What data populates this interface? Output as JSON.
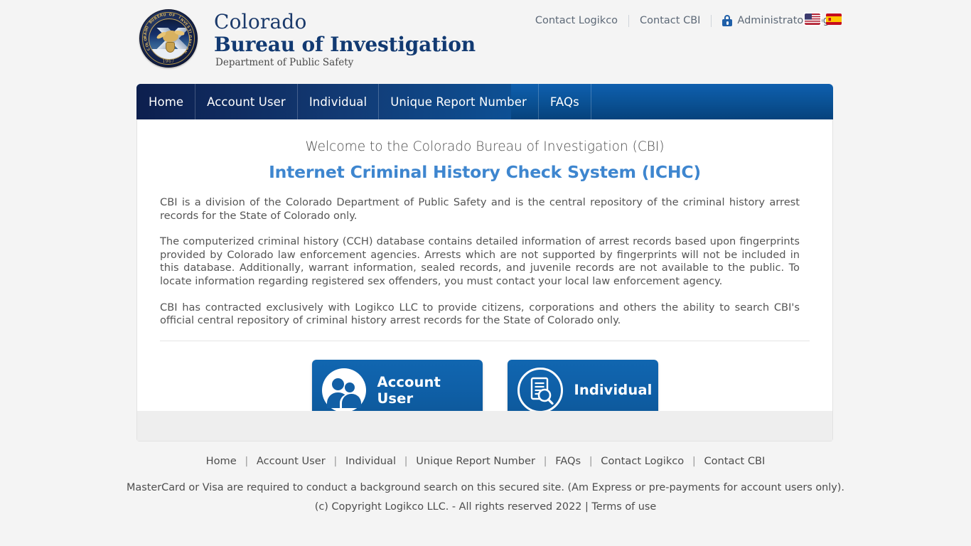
{
  "header": {
    "seal": {
      "ring_text": "COLORADO BUREAU OF INVESTIGATION",
      "year": "1967"
    },
    "title_line1": "Colorado",
    "title_line2": "Bureau of Investigation",
    "subtitle": "Department of Public Safety",
    "top_links": [
      {
        "label": "Contact Logikco"
      },
      {
        "label": "Contact CBI"
      }
    ],
    "admin_login": "Administrator Login",
    "lock_icon": "lock-icon",
    "languages": [
      {
        "code": "en",
        "name": "english-flag",
        "selected": true
      },
      {
        "code": "es",
        "name": "spanish-flag",
        "selected": false
      }
    ]
  },
  "nav": {
    "items": [
      {
        "label": "Home"
      },
      {
        "label": "Account User"
      },
      {
        "label": "Individual"
      },
      {
        "label": "Unique Report Number"
      },
      {
        "label": "FAQs"
      }
    ]
  },
  "main": {
    "welcome": "Welcome to the Colorado Bureau of Investigation (CBI)",
    "system_title": "Internet Criminal History Check System (ICHC)",
    "paragraphs": [
      "CBI is a division of the Colorado Department of Public Safety and is the central repository of the criminal history arrest records for the State of Colorado only.",
      "The computerized criminal history (CCH) database contains detailed information of arrest records based upon fingerprints provided by Colorado law enforcement agencies. Arrests which are not supported by fingerprints will not be included in this database. Additionally, warrant information, sealed records, and juvenile records are not available to the public. To locate information regarding registered sex offenders, you must contact your local law enforcement agency.",
      "CBI has contracted exclusively with Logikco LLC to provide citizens, corporations and others the ability to search CBI's official central repository of criminal history arrest records for the State of Colorado only."
    ],
    "buttons": [
      {
        "label": "Account User",
        "icon": "users-icon"
      },
      {
        "label": "Individual",
        "icon": "document-search-icon"
      }
    ]
  },
  "footer": {
    "links": [
      {
        "label": "Home"
      },
      {
        "label": "Account User"
      },
      {
        "label": "Individual"
      },
      {
        "label": "Unique Report Number"
      },
      {
        "label": "FAQs"
      },
      {
        "label": "Contact Logikco"
      },
      {
        "label": "Contact CBI"
      }
    ],
    "separator": "|",
    "payment_note": "MasterCard or Visa are required to conduct a background search on this secured site. (Am Express or pre-payments for account users only).",
    "copyright": "(c) Copyright Logikco LLC. - All rights reserved 2022 |",
    "terms": "Terms of use"
  },
  "colors": {
    "brand_navy": "#123a72",
    "accent_blue": "#3e86cf",
    "button_blue": "#0f60a8",
    "page_bg": "#f4f4f4"
  }
}
